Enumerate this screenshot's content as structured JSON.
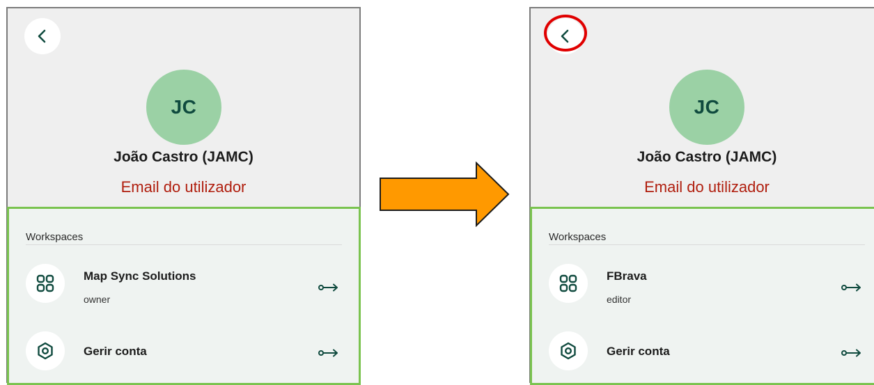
{
  "colors": {
    "avatar_bg": "#9bd1a5",
    "avatar_text": "#0f4a3e",
    "email_text": "#b01e0e",
    "highlight_border": "#7ac34f",
    "arrow_fill": "#ff9900",
    "annotation_circle": "#e00000",
    "icon_color": "#0f4a3e"
  },
  "left_panel": {
    "back_icon": "chevron-left-icon",
    "avatar_initials": "JC",
    "user_name": "João Castro (JAMC)",
    "user_email": "Email do utilizador",
    "workspaces_header": "Workspaces",
    "workspace": {
      "icon": "grid-icon",
      "name": "Map Sync Solutions",
      "role": "owner",
      "action_icon": "key-arrow-icon"
    },
    "manage_account": {
      "icon": "settings-icon",
      "label": "Gerir conta",
      "action_icon": "key-arrow-icon"
    }
  },
  "right_panel": {
    "back_icon": "chevron-left-icon",
    "avatar_initials": "JC",
    "user_name": "João Castro (JAMC)",
    "user_email": "Email do utilizador",
    "workspaces_header": "Workspaces",
    "workspace": {
      "icon": "grid-icon",
      "name": "FBrava",
      "role": "editor",
      "action_icon": "key-arrow-icon"
    },
    "manage_account": {
      "icon": "settings-icon",
      "label": "Gerir conta",
      "action_icon": "key-arrow-icon"
    }
  },
  "annotation": {
    "transition_arrow": "right-arrow",
    "highlight": "back-button"
  }
}
